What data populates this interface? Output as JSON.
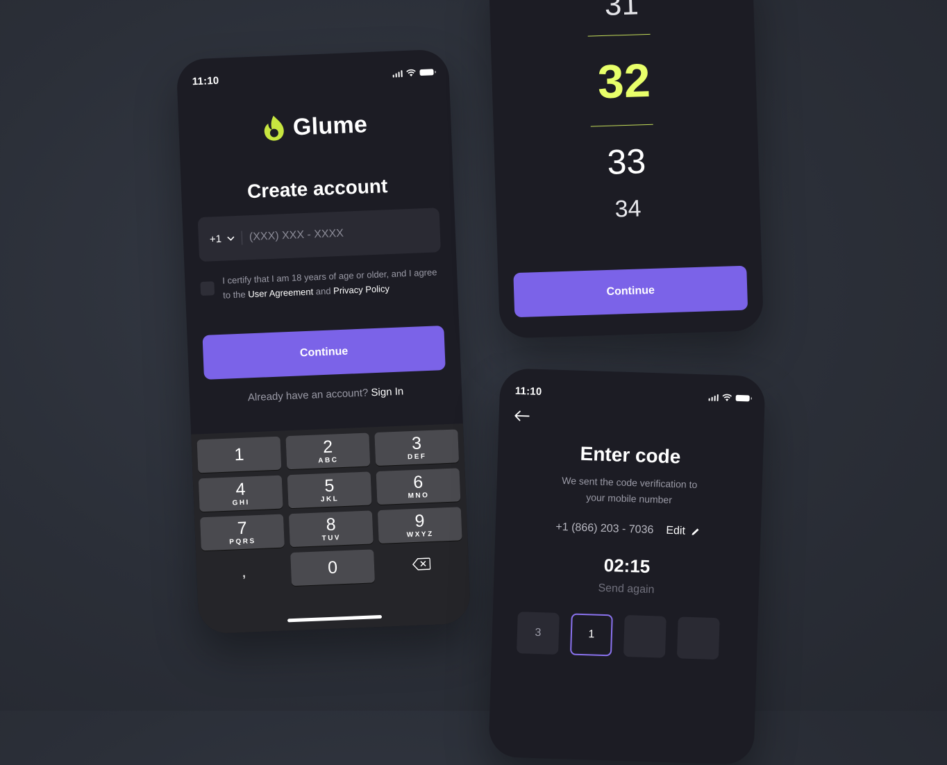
{
  "status": {
    "time": "11:10"
  },
  "signup": {
    "brand": "Glume",
    "title": "Create account",
    "country_code": "+1",
    "phone_placeholder": "(XXX) XXX - XXXX",
    "certify_prefix": "I certify that I am 18 years of age or older, and I agree to the",
    "user_agreement": "User Agreement",
    "and": "and",
    "privacy_policy": "Privacy Policy",
    "continue_label": "Continue",
    "already_text": "Already have an account?",
    "sign_in": "Sign In"
  },
  "keypad": {
    "keys": [
      {
        "n": "1",
        "l": ""
      },
      {
        "n": "2",
        "l": "ABC"
      },
      {
        "n": "3",
        "l": "DEF"
      },
      {
        "n": "4",
        "l": "GHI"
      },
      {
        "n": "5",
        "l": "JKL"
      },
      {
        "n": "6",
        "l": "MNO"
      },
      {
        "n": "7",
        "l": "PQRS"
      },
      {
        "n": "8",
        "l": "TUV"
      },
      {
        "n": "9",
        "l": "WXYZ"
      }
    ],
    "comma": ",",
    "zero": "0",
    "delete_icon": "backspace-icon"
  },
  "picker": {
    "values": [
      "31",
      "32",
      "33",
      "34"
    ],
    "selected": "32",
    "continue_label": "Continue",
    "accent_color": "#e8ff6a"
  },
  "verify": {
    "title": "Enter code",
    "subtitle_line1": "We sent the code verification to",
    "subtitle_line2": "your mobile number",
    "phone_number": "+1 (866) 203 - 7036",
    "edit_label": "Edit",
    "timer": "02:15",
    "send_again": "Send again",
    "code_digits": [
      "3",
      "1",
      "",
      ""
    ]
  },
  "colors": {
    "primary": "#7b63e8",
    "accent": "#e8ff6a",
    "card": "#1c1c24"
  }
}
